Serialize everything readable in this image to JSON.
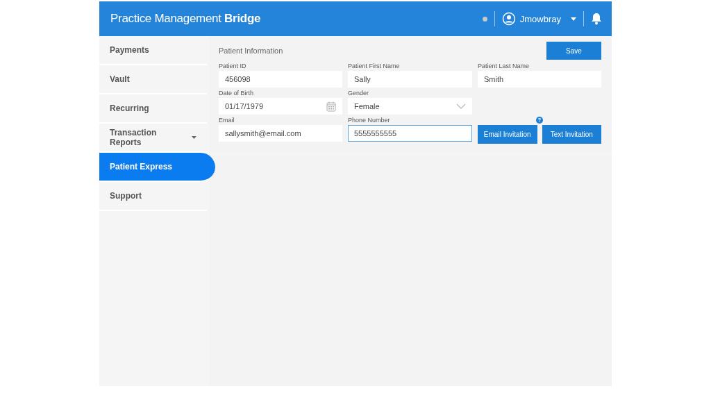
{
  "header": {
    "logo": "Practice Management **Bridge**",
    "user": "Jmowbray"
  },
  "sidebar": {
    "items": [
      {
        "label": "Payments",
        "selected": false,
        "has_menu": false
      },
      {
        "label": "Vault",
        "selected": false,
        "has_menu": false
      },
      {
        "label": "Recurring",
        "selected": false,
        "has_menu": false
      },
      {
        "label": "Transaction Reports",
        "selected": false,
        "has_menu": true
      },
      {
        "label": "Patient Express",
        "selected": true,
        "has_menu": false
      },
      {
        "label": "Support",
        "selected": false,
        "has_menu": false
      }
    ]
  },
  "form": {
    "title": "Patient Information",
    "save": "Save",
    "fields": [
      {
        "kind": "text",
        "label": "Patient ID",
        "value": "456098",
        "focused": false
      },
      {
        "kind": "text",
        "label": "Patient First Name",
        "value": "Sally",
        "focused": false
      },
      {
        "kind": "text",
        "label": "Patient Last Name",
        "value": "Smith",
        "focused": false
      },
      {
        "kind": "date",
        "label": "Date of Birth",
        "value": "01/17/1979",
        "focused": false
      },
      {
        "kind": "select",
        "label": "Gender",
        "value": "Female",
        "focused": false
      },
      {
        "kind": "empty"
      },
      {
        "kind": "text",
        "label": "Email",
        "value": "sallysmith@email.com",
        "focused": false
      },
      {
        "kind": "text",
        "label": "Phone Number",
        "value": "5555555555",
        "focused": true
      },
      {
        "kind": "buttons",
        "help": "?",
        "buttons": [
          "Email Invitation",
          "Text Invitation"
        ]
      }
    ]
  }
}
